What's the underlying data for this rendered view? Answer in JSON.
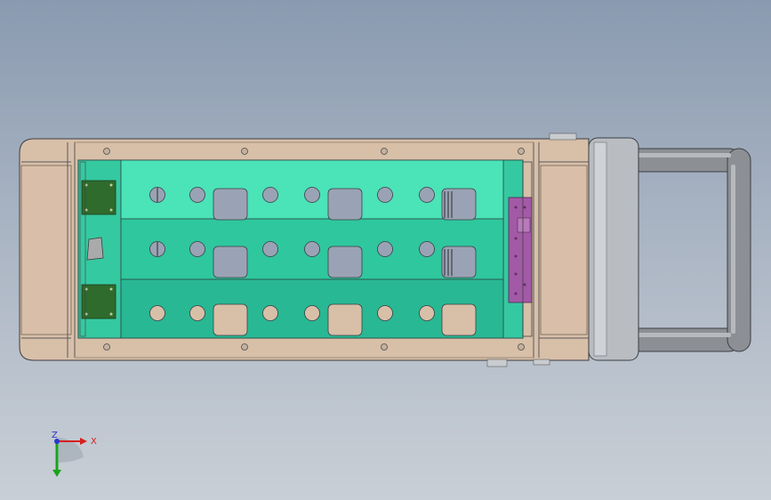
{
  "view": {
    "background_top": "#8a9ab0",
    "background_bottom": "#c9cfd6"
  },
  "model": {
    "frame_color": "#d8bfa8",
    "tray_colors": [
      "#4be3b8",
      "#2fc79e",
      "#28b893"
    ],
    "bracket_color": "#a35aa6",
    "pcb_color": "#2f6b2c",
    "handle_color": "#8c8f94",
    "hole_color": "#9aa3b5",
    "slots_per_row": 3,
    "rows": 3
  },
  "triad": {
    "x_label": "X",
    "z_label": "Z",
    "x_color": "#d62020",
    "y_color": "#1aa31a",
    "z_color": "#2a36c9"
  }
}
